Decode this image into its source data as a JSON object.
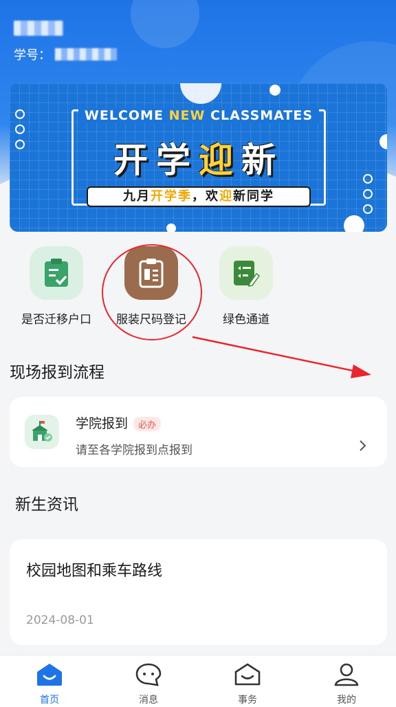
{
  "header": {
    "student_no_label": "学号："
  },
  "banner": {
    "welcome_a": "WELCOME ",
    "welcome_new": "NEW",
    "welcome_b": " CLASSMATES",
    "title_a": "开学",
    "title_b": "迎",
    "title_c": "新",
    "sub_a": "九月",
    "sub_b": "开学季",
    "sub_c": "，欢",
    "sub_d": "迎",
    "sub_e": "新",
    "sub_f": "同学"
  },
  "quick": [
    {
      "label": "是否迁移户口",
      "icon": "clipboard-check-icon",
      "bg": "#d9f0e2",
      "fg": "#3aa36a"
    },
    {
      "label": "服装尺码登记",
      "icon": "clipboard-list-icon",
      "bg": "#9b6b4e",
      "fg": "#ffffff"
    },
    {
      "label": "绿色通道",
      "icon": "note-edit-icon",
      "bg": "#e6f2e0",
      "fg": "#3b8a3a"
    }
  ],
  "report_section": {
    "title": "现场报到流程",
    "item_title": "学院报到",
    "badge": "必办",
    "item_desc": "请至各学院报到点报到"
  },
  "news_section": {
    "title": "新生资讯",
    "card_title": "校园地图和乘车路线",
    "card_date": "2024-08-01"
  },
  "nav": [
    {
      "label": "首页",
      "icon": "home-icon",
      "active": true
    },
    {
      "label": "消息",
      "icon": "message-icon",
      "active": false
    },
    {
      "label": "事务",
      "icon": "mail-icon",
      "active": false
    },
    {
      "label": "我的",
      "icon": "user-icon",
      "active": false
    }
  ],
  "colors": {
    "accent": "#1e74e6",
    "annotation": "#e8262c"
  }
}
